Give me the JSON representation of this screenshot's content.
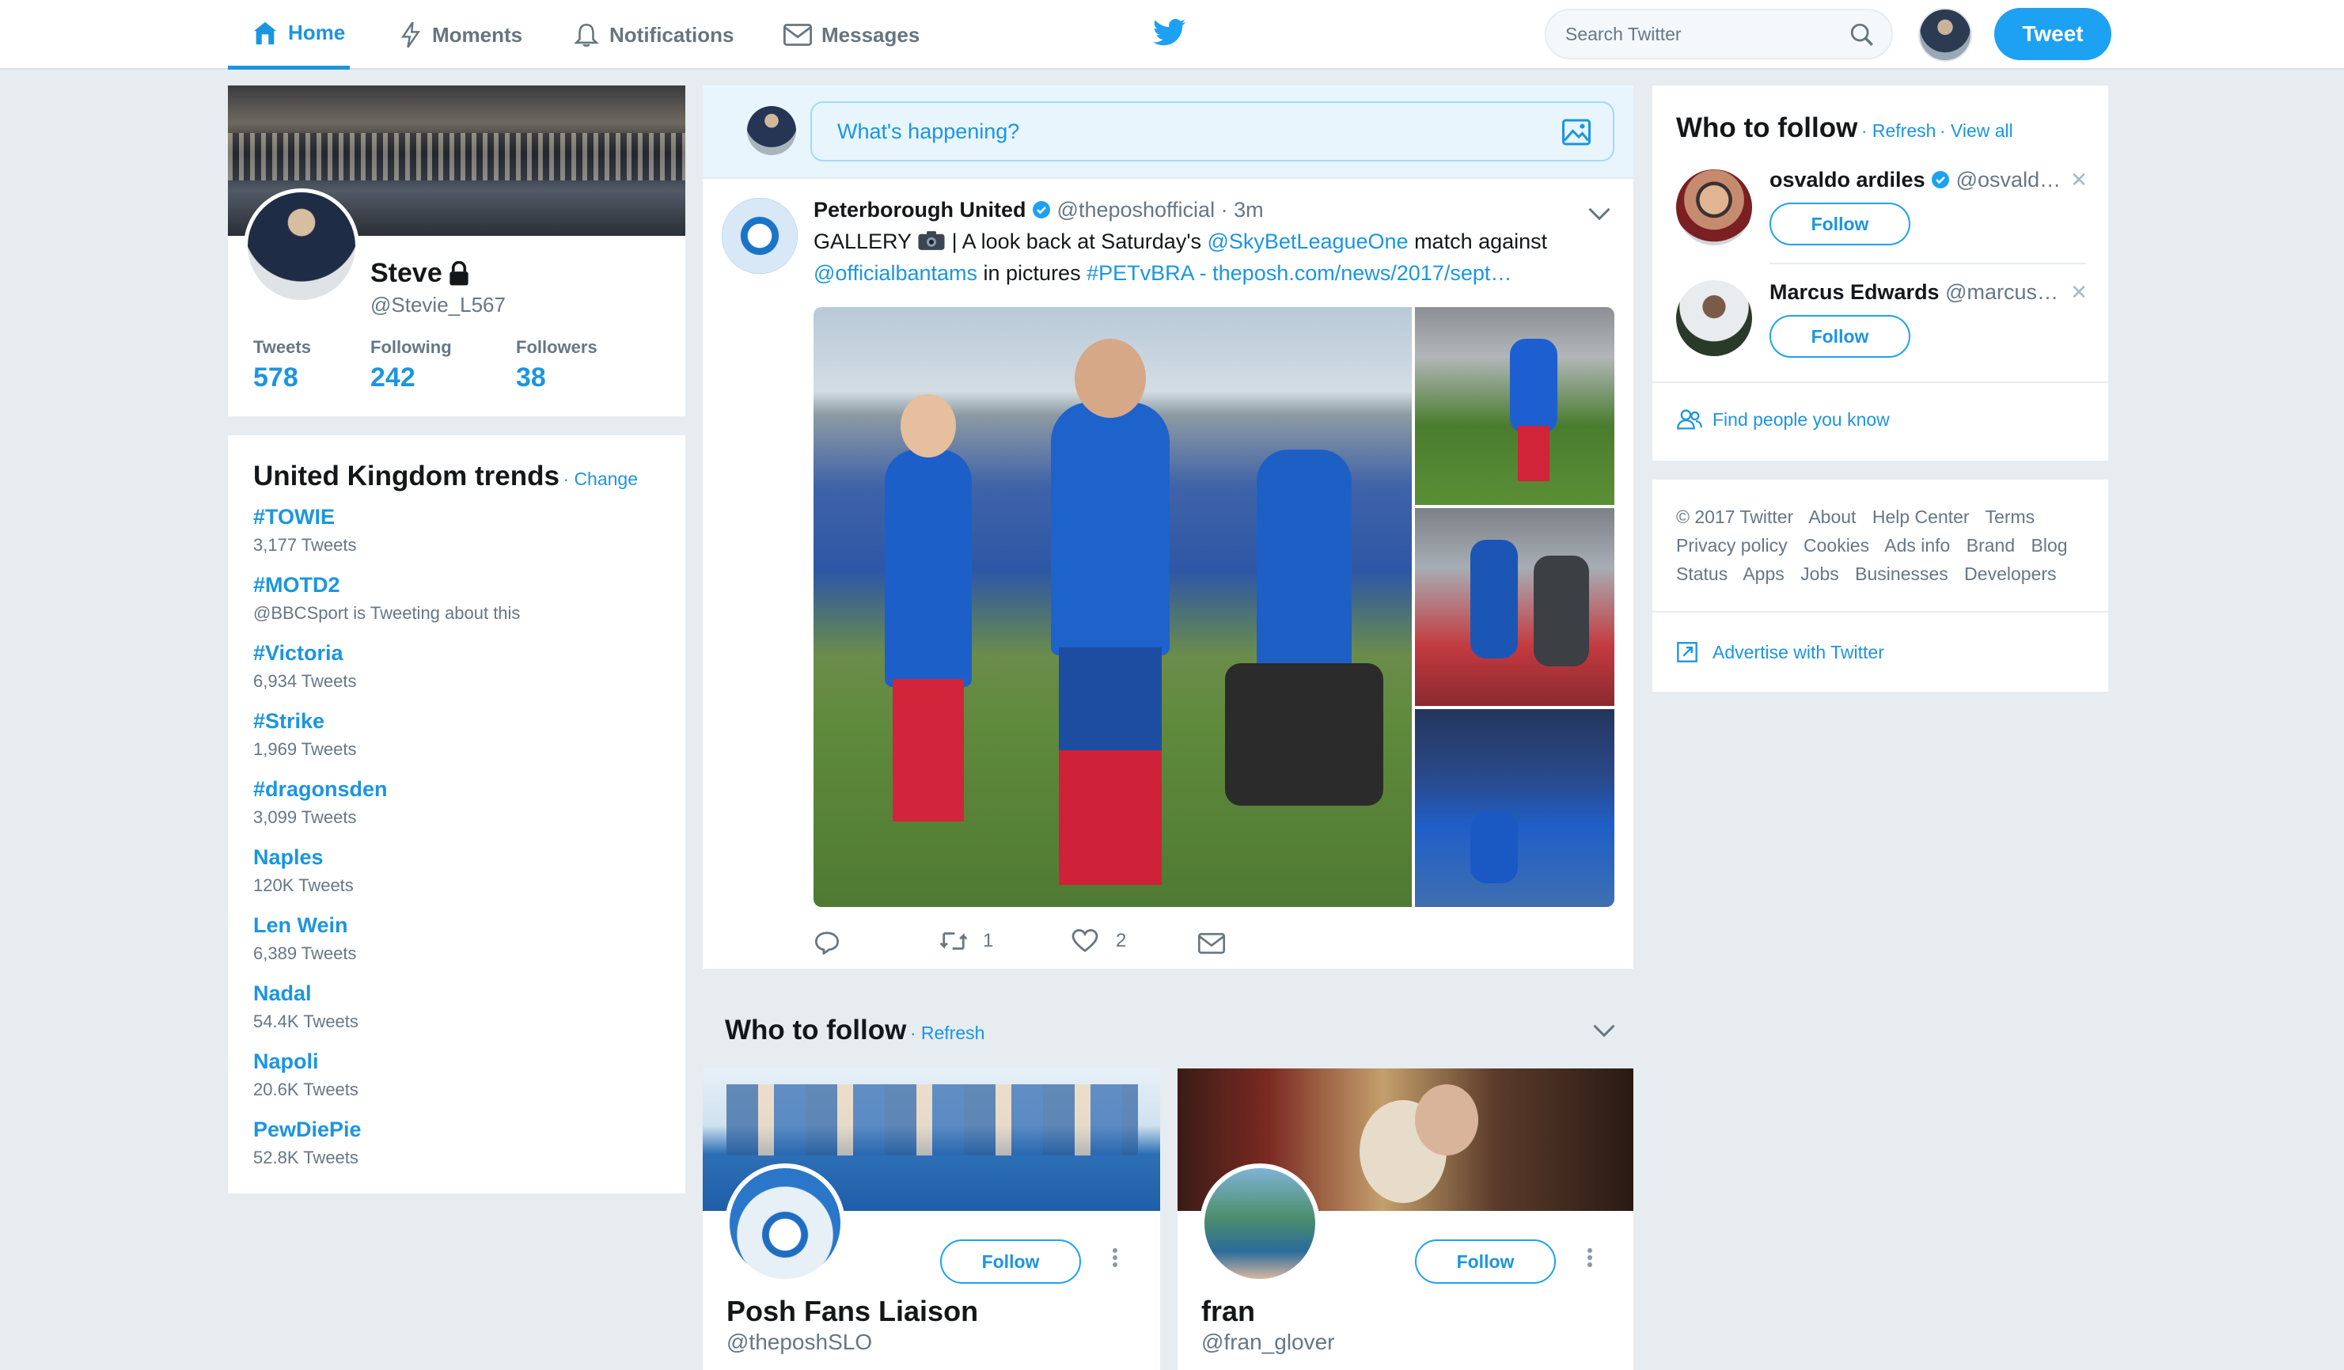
{
  "nav": {
    "home": "Home",
    "moments": "Moments",
    "notifications": "Notifications",
    "messages": "Messages",
    "search_placeholder": "Search Twitter",
    "tweet_button": "Tweet"
  },
  "profile": {
    "name": "Steve",
    "handle": "@Stevie_L567",
    "stats": [
      {
        "label": "Tweets",
        "value": "578"
      },
      {
        "label": "Following",
        "value": "242"
      },
      {
        "label": "Followers",
        "value": "38"
      }
    ]
  },
  "trends": {
    "title": "United Kingdom trends",
    "change": "· Change",
    "items": [
      {
        "name": "#TOWIE",
        "sub": "3,177 Tweets"
      },
      {
        "name": "#MOTD2",
        "sub": "@BBCSport is Tweeting about this"
      },
      {
        "name": "#Victoria",
        "sub": "6,934 Tweets"
      },
      {
        "name": "#Strike",
        "sub": "1,969 Tweets"
      },
      {
        "name": "#dragonsden",
        "sub": "3,099 Tweets"
      },
      {
        "name": "Naples",
        "sub": "120K Tweets"
      },
      {
        "name": "Len Wein",
        "sub": "6,389 Tweets"
      },
      {
        "name": "Nadal",
        "sub": "54.4K Tweets"
      },
      {
        "name": "Napoli",
        "sub": "20.6K Tweets"
      },
      {
        "name": "PewDiePie",
        "sub": "52.8K Tweets"
      }
    ]
  },
  "compose": {
    "placeholder": "What's happening?"
  },
  "tweet": {
    "author": "Peterborough United",
    "handle": "@theposhofficial",
    "time": "· 3m",
    "line1_prefix": "GALLERY",
    "line1_mid": " | A look back at Saturday's ",
    "mention1": "@SkyBetLeagueOne",
    "line1_suffix": " match against",
    "mention2": "@officialbantams",
    "line2_mid": " in pictures ",
    "hashtag": "#PETvBRA",
    "dash": " - ",
    "url": "theposh.com/news/2017/sept…",
    "retweets": "1",
    "likes": "2"
  },
  "wtf_main": {
    "title": "Who to follow",
    "refresh": "· Refresh",
    "cards": [
      {
        "name": "Posh Fans Liaison",
        "handle": "@theposhSLO",
        "follow": "Follow"
      },
      {
        "name": "fran",
        "handle": "@fran_glover",
        "follow": "Follow"
      }
    ]
  },
  "wtf_side": {
    "title": "Who to follow",
    "refresh": "· Refresh",
    "view_all": "· View all",
    "users": [
      {
        "name": "osvaldo ardiles",
        "handle": "@osvald…",
        "follow": "Follow"
      },
      {
        "name": "Marcus Edwards",
        "handle": "@marcus…",
        "follow": "Follow"
      }
    ],
    "find_people": "Find people you know"
  },
  "footer": {
    "row1": [
      "© 2017 Twitter",
      "About",
      "Help Center",
      "Terms"
    ],
    "row2": [
      "Privacy policy",
      "Cookies",
      "Ads info",
      "Brand",
      "Blog"
    ],
    "row3": [
      "Status",
      "Apps",
      "Jobs",
      "Businesses",
      "Developers"
    ],
    "advertise": "Advertise with Twitter"
  }
}
